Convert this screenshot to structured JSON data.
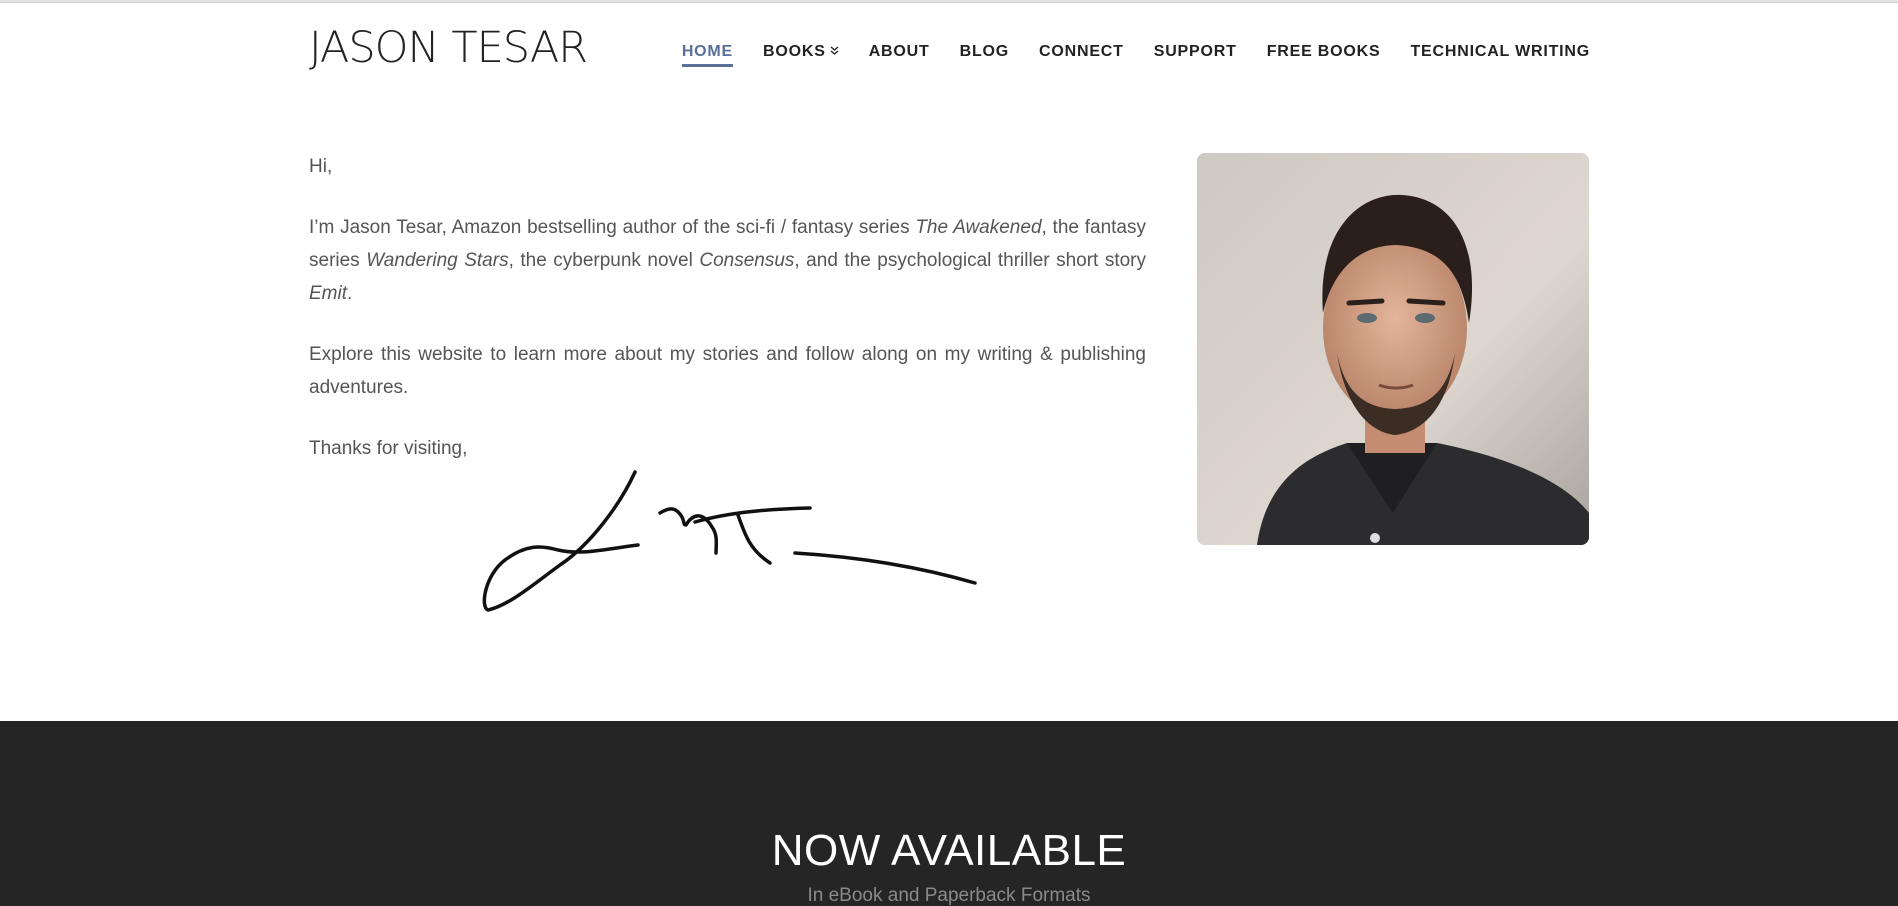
{
  "site": {
    "title": "JASON TESAR"
  },
  "nav": {
    "items": [
      {
        "label": "HOME",
        "active": true
      },
      {
        "label": "BOOKS",
        "has_dropdown": true
      },
      {
        "label": "ABOUT"
      },
      {
        "label": "BLOG"
      },
      {
        "label": "CONNECT"
      },
      {
        "label": "SUPPORT"
      },
      {
        "label": "FREE BOOKS"
      },
      {
        "label": "TECHNICAL WRITING"
      }
    ],
    "dropdown_icon": "double-chevron-down-icon"
  },
  "intro": {
    "greeting": "Hi,",
    "p2_a": "I’m Jason Tesar, Amazon bestselling author of the sci-fi / fantasy series ",
    "p2_b": "The Awakened",
    "p2_c": ", the fantasy series ",
    "p2_d": "Wandering Stars",
    "p2_e": ", the cyberpunk novel ",
    "p2_f": "Consensus",
    "p2_g": ", and the psychological thriller short story ",
    "p2_h": "Emit",
    "p2_i": ".",
    "p3": "Explore this website to learn more about my stories and follow along on my writing & publishing adventures.",
    "closing": "Thanks for visiting,"
  },
  "colors": {
    "accent": "#5a6f9a",
    "footer_bg": "#252525",
    "body_text": "#555555"
  },
  "footer": {
    "title": "NOW AVAILABLE",
    "subtitle": "In eBook and Paperback Formats"
  }
}
